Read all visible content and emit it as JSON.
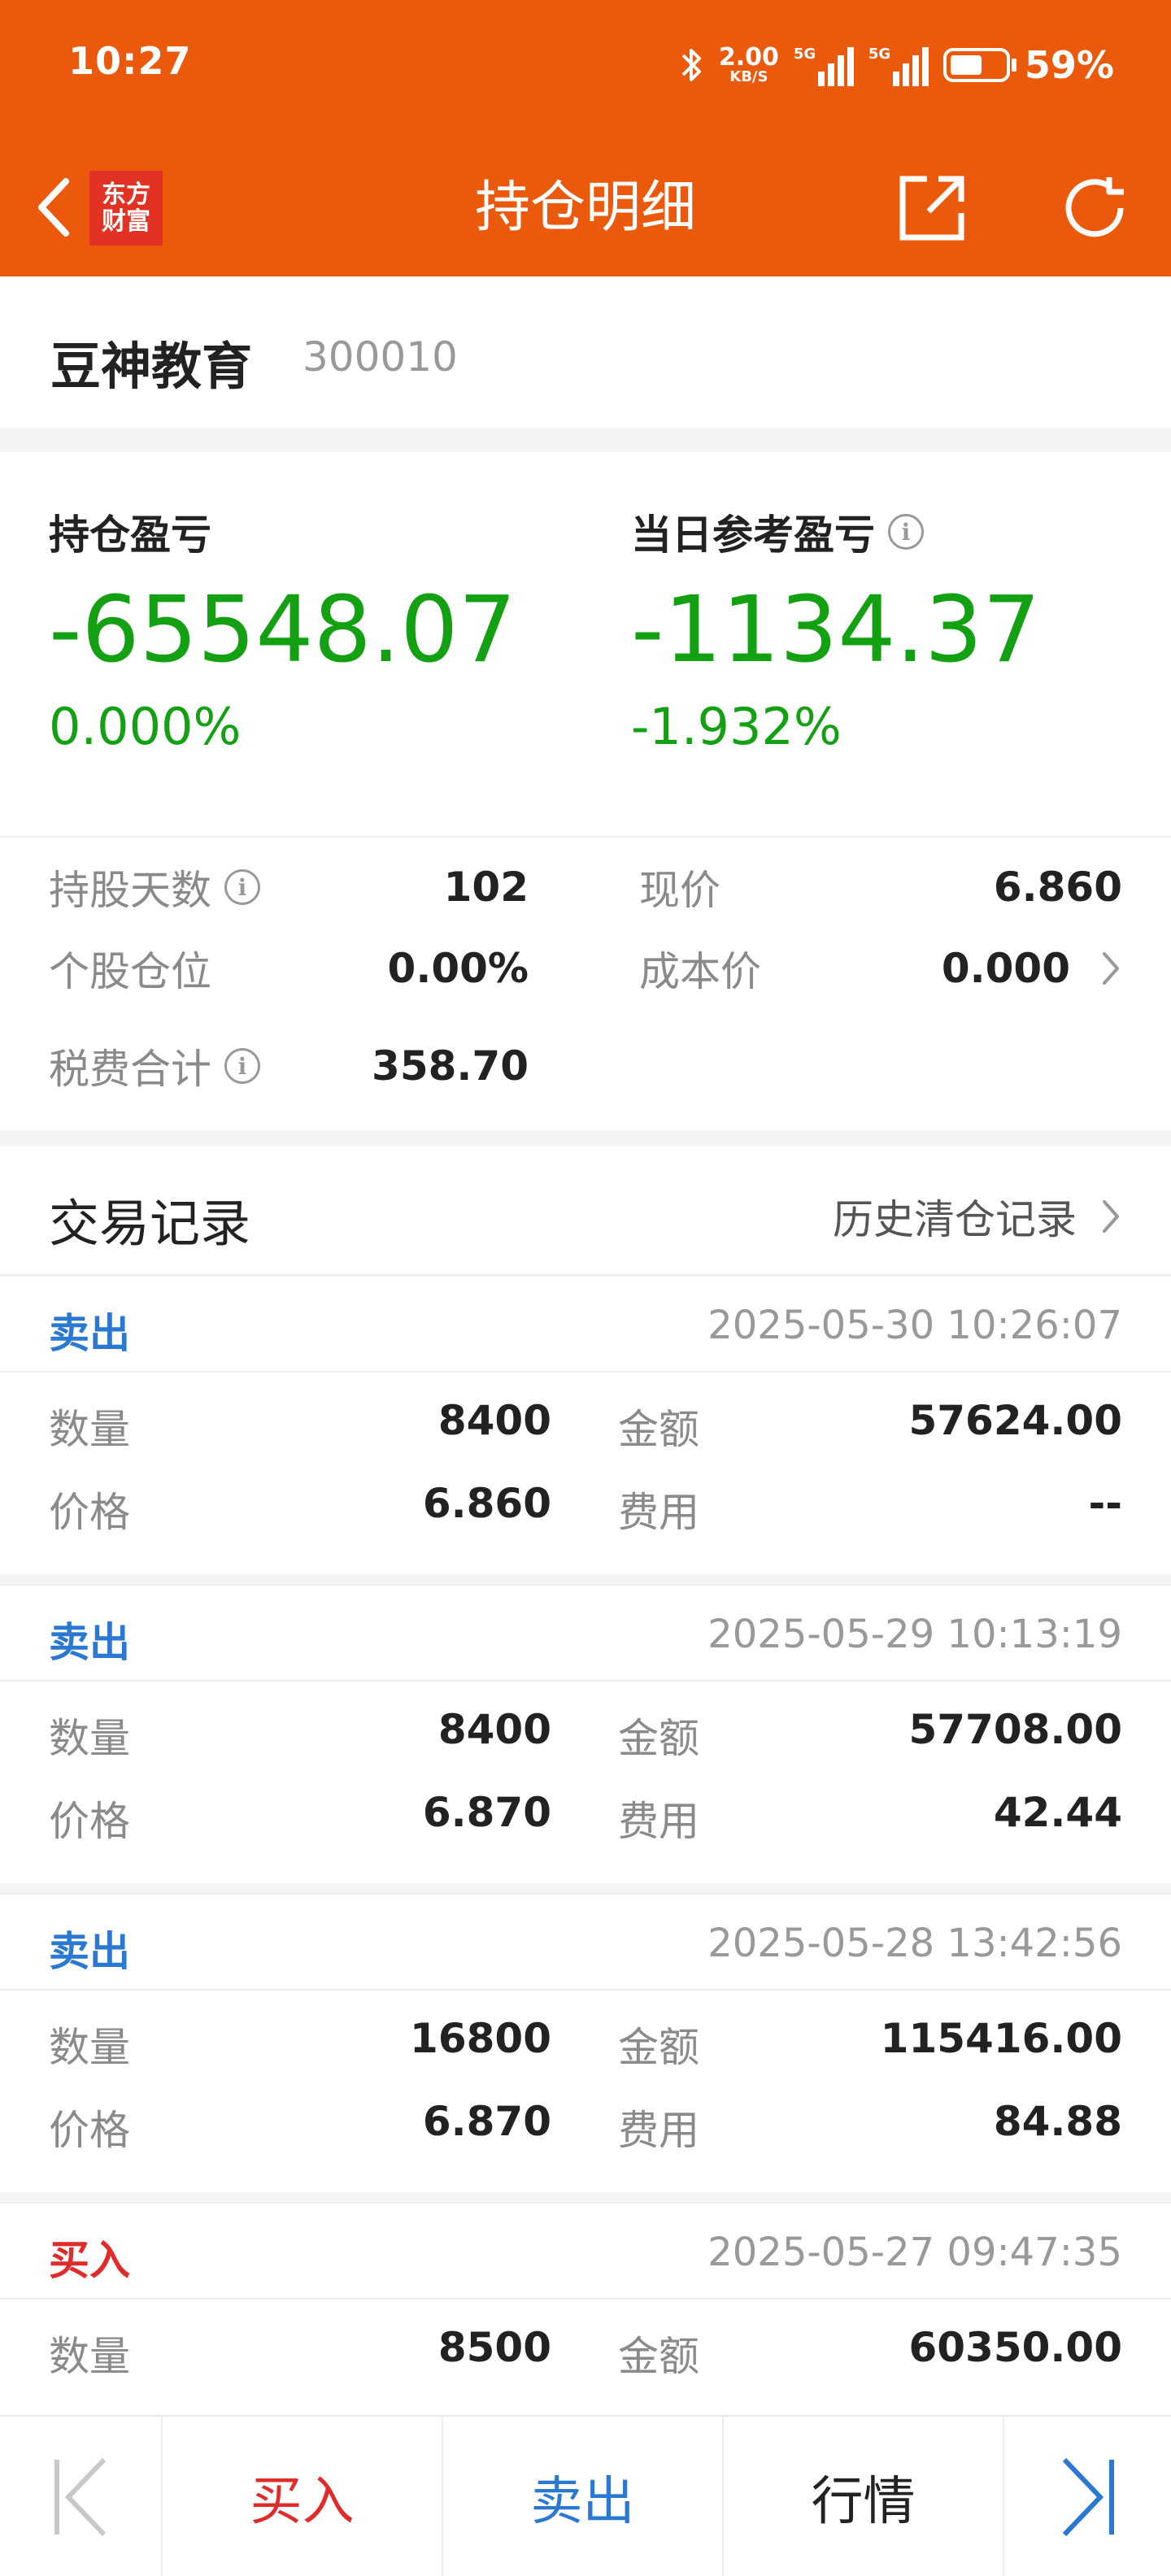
{
  "status_bar": {
    "time": "10:27",
    "net_speed": "2.00",
    "net_unit": "KB/S",
    "signal1_tag": "5G",
    "signal2_tag": "5G",
    "battery_percent_text": "59%",
    "battery_level": 0.59
  },
  "nav": {
    "logo_line1": "东方",
    "logo_line2": "财富",
    "title": "持仓明细"
  },
  "stock": {
    "name": "豆神教育",
    "code": "300010"
  },
  "pnl": {
    "position_label": "持仓盈亏",
    "position_value": "-65548.07",
    "position_pct": "0.000%",
    "daily_label": "当日参考盈亏",
    "daily_value": "-1134.37",
    "daily_pct": "-1.932%"
  },
  "metrics": {
    "hold_days_label": "持股天数",
    "hold_days_value": "102",
    "weight_label": "个股仓位",
    "weight_value": "0.00%",
    "fees_label": "税费合计",
    "fees_value": "358.70",
    "price_label": "现价",
    "price_value": "6.860",
    "cost_label": "成本价",
    "cost_value": "0.000"
  },
  "trades_section": {
    "title": "交易记录",
    "history_link": "历史清仓记录"
  },
  "trade_labels": {
    "qty": "数量",
    "amount": "金额",
    "price": "价格",
    "fee": "费用"
  },
  "trades": [
    {
      "type": "卖出",
      "time": "2025-05-30 10:26:07",
      "qty": "8400",
      "amount": "57624.00",
      "price": "6.860",
      "fee": "--"
    },
    {
      "type": "卖出",
      "time": "2025-05-29 10:13:19",
      "qty": "8400",
      "amount": "57708.00",
      "price": "6.870",
      "fee": "42.44"
    },
    {
      "type": "卖出",
      "time": "2025-05-28 13:42:56",
      "qty": "16800",
      "amount": "115416.00",
      "price": "6.870",
      "fee": "84.88"
    },
    {
      "type": "买入",
      "time": "2025-05-27 09:47:35",
      "qty": "8500",
      "amount": "60350.00",
      "price": "",
      "fee": ""
    }
  ],
  "bottom_bar": {
    "buy": "买入",
    "sell": "卖出",
    "quote": "行情"
  },
  "colors": {
    "brand": "#eb5a0c",
    "loss_green": "#13a012",
    "sell_blue": "#2a78d2",
    "buy_red": "#e02b2b"
  },
  "icons": [
    "back-icon",
    "share-icon",
    "refresh-icon",
    "info-icon",
    "chevron-right-icon",
    "first-page-icon",
    "last-page-icon",
    "bluetooth-icon",
    "signal-icon",
    "battery-icon"
  ]
}
